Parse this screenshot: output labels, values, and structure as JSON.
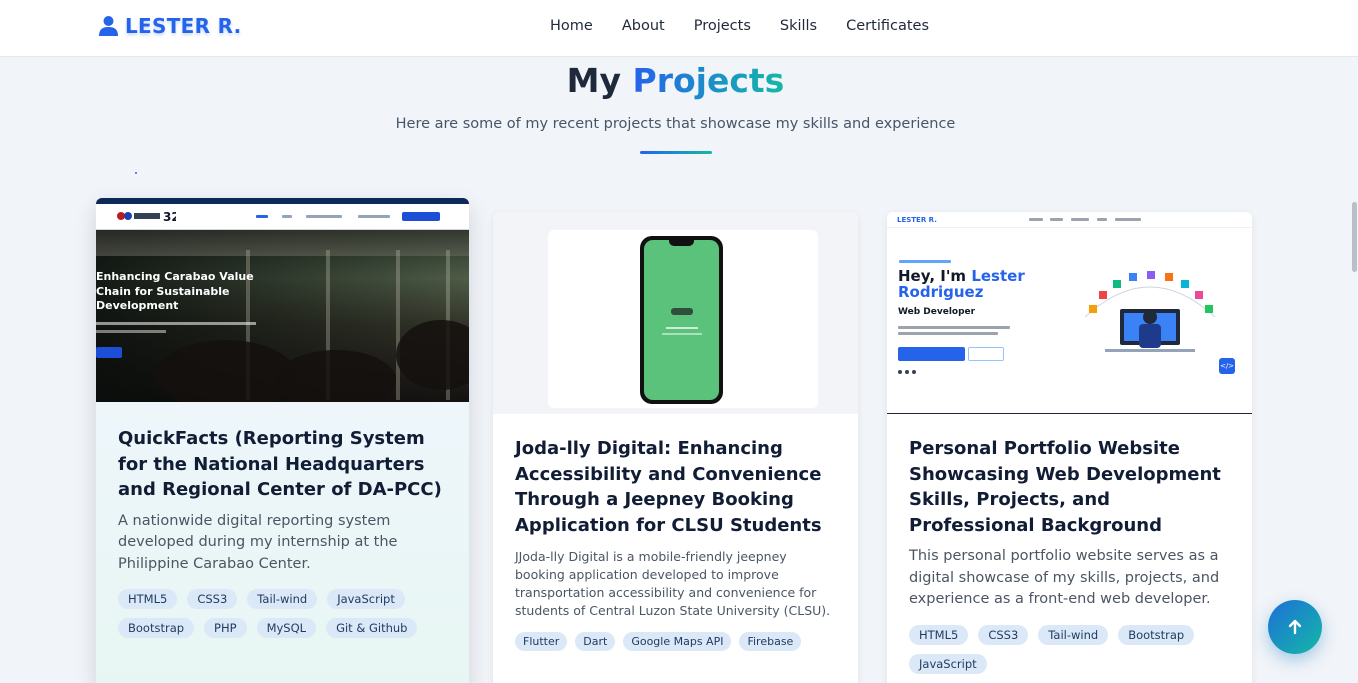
{
  "brand": {
    "name": "LESTER R.",
    "icon": "user-icon"
  },
  "nav": {
    "links": [
      {
        "label": "Home"
      },
      {
        "label": "About"
      },
      {
        "label": "Projects"
      },
      {
        "label": "Skills"
      },
      {
        "label": "Certificates"
      }
    ]
  },
  "header": {
    "title_part1": "My",
    "title_part2": "Projects",
    "subtitle": "Here are some of my recent projects that showcase my skills and experience"
  },
  "projects": [
    {
      "title": "QuickFacts (Reporting System for the National Headquarters and Regional Center of DA-PCC)",
      "description": "A nationwide digital reporting system developed during my internship at the Philippine Carabao Center.",
      "image": {
        "heading": "Enhancing Carabao Value Chain for Sustainable Development"
      },
      "tags": [
        "HTML5",
        "CSS3",
        "Tail-wind",
        "JavaScript",
        "Bootstrap",
        "PHP",
        "MySQL",
        "Git & Github"
      ]
    },
    {
      "title": "Joda-lly Digital: Enhancing Accessibility and Convenience Through a Jeepney Booking Application for CLSU Students",
      "description": "JJoda-lly Digital is a mobile-friendly jeepney booking application developed to improve transportation accessibility and convenience for students of Central Luzon State University (CLSU).",
      "tags": [
        "Flutter",
        "Dart",
        "Google Maps API",
        "Firebase"
      ]
    },
    {
      "title": "Personal Portfolio Website Showcasing Web Development Skills, Projects, and Professional Background",
      "description": "This personal portfolio website serves as a digital showcase of my skills, projects, and experience as a front-end web developer.",
      "image": {
        "brand": "LESTER R.",
        "greeting": "Hey, I'm",
        "name": "Lester Rodriguez",
        "role": "Web Developer"
      },
      "tags": [
        "HTML5",
        "CSS3",
        "Tail-wind",
        "Bootstrap",
        "JavaScript"
      ]
    }
  ],
  "scroll_top": {
    "icon": "arrow-up-icon"
  },
  "colors": {
    "accent_blue": "#2563eb",
    "accent_teal": "#14b8a6",
    "tag_bg": "#dbe8f7"
  }
}
